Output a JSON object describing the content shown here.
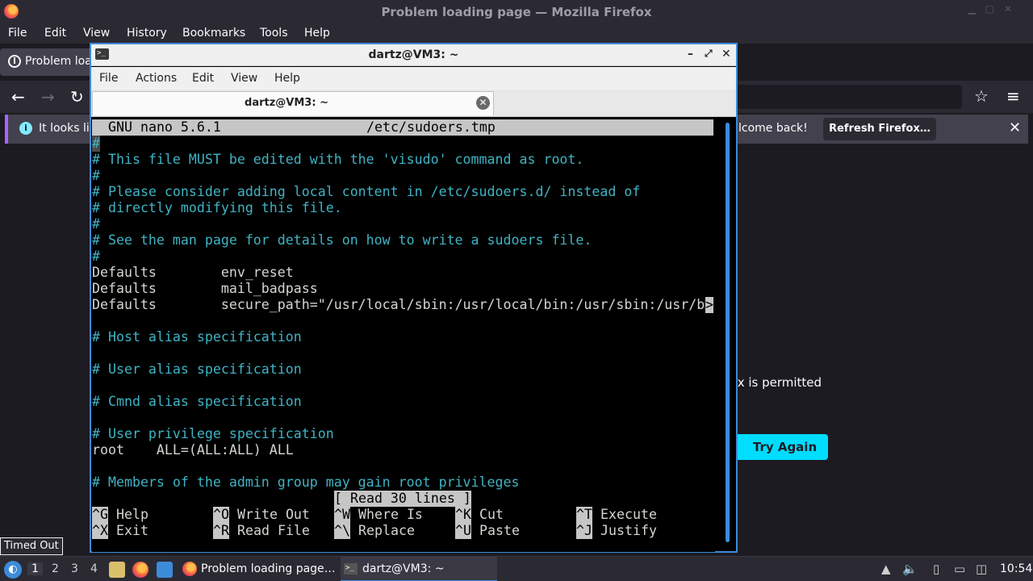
{
  "firefox": {
    "window_title": "Problem loading page — Mozilla Firefox",
    "menu": [
      "File",
      "Edit",
      "View",
      "History",
      "Bookmarks",
      "Tools",
      "Help"
    ],
    "tab_label": "Problem loa",
    "notification_text_left": "It looks lik",
    "notification_text_right": "lcome back!",
    "refresh_button": "Refresh Firefox…",
    "content_text": "ox is permitted",
    "try_again_button": "Try Again",
    "status_tooltip": "Timed Out"
  },
  "terminal": {
    "window_title": "dartz@VM3: ~",
    "menu": [
      "File",
      "Actions",
      "Edit",
      "View",
      "Help"
    ],
    "tab_label": "dartz@VM3: ~",
    "nano": {
      "header_app": "GNU nano 5.6.1",
      "header_file": "/etc/sudoers.tmp",
      "lines": [
        {
          "text": "#",
          "type": "comment"
        },
        {
          "text": "# This file MUST be edited with the 'visudo' command as root.",
          "type": "comment"
        },
        {
          "text": "#",
          "type": "comment"
        },
        {
          "text": "# Please consider adding local content in /etc/sudoers.d/ instead of",
          "type": "comment"
        },
        {
          "text": "# directly modifying this file.",
          "type": "comment"
        },
        {
          "text": "#",
          "type": "comment"
        },
        {
          "text": "# See the man page for details on how to write a sudoers file.",
          "type": "comment"
        },
        {
          "text": "#",
          "type": "comment"
        },
        {
          "text": "Defaults        env_reset",
          "type": "code"
        },
        {
          "text": "Defaults        mail_badpass",
          "type": "code"
        },
        {
          "text": "Defaults        secure_path=\"/usr/local/sbin:/usr/local/bin:/usr/sbin:/usr/b",
          "type": "code"
        },
        {
          "text": "",
          "type": "code"
        },
        {
          "text": "# Host alias specification",
          "type": "comment"
        },
        {
          "text": "",
          "type": "code"
        },
        {
          "text": "# User alias specification",
          "type": "comment"
        },
        {
          "text": "",
          "type": "code"
        },
        {
          "text": "# Cmnd alias specification",
          "type": "comment"
        },
        {
          "text": "",
          "type": "code"
        },
        {
          "text": "# User privilege specification",
          "type": "comment"
        },
        {
          "text": "root    ALL=(ALL:ALL) ALL",
          "type": "code"
        },
        {
          "text": "",
          "type": "code"
        },
        {
          "text": "# Members of the admin group may gain root privileges",
          "type": "comment"
        }
      ],
      "overflow_marker": ">",
      "status": "[ Read 30 lines ]",
      "shortcuts_row1": [
        {
          "key": "^G",
          "label": "Help"
        },
        {
          "key": "^O",
          "label": "Write Out"
        },
        {
          "key": "^W",
          "label": "Where Is"
        },
        {
          "key": "^K",
          "label": "Cut"
        },
        {
          "key": "^T",
          "label": "Execute"
        }
      ],
      "shortcuts_row2": [
        {
          "key": "^X",
          "label": "Exit"
        },
        {
          "key": "^R",
          "label": "Read File"
        },
        {
          "key": "^\\",
          "label": "Replace"
        },
        {
          "key": "^U",
          "label": "Paste"
        },
        {
          "key": "^J",
          "label": "Justify"
        }
      ]
    }
  },
  "taskbar": {
    "workspaces": [
      "1",
      "2",
      "3",
      "4"
    ],
    "tasks": [
      {
        "label": "Problem loading page…",
        "icon": "firefox-icon"
      },
      {
        "label": "dartz@VM3: ~",
        "icon": "terminal-icon"
      }
    ],
    "clock": "10:54"
  }
}
